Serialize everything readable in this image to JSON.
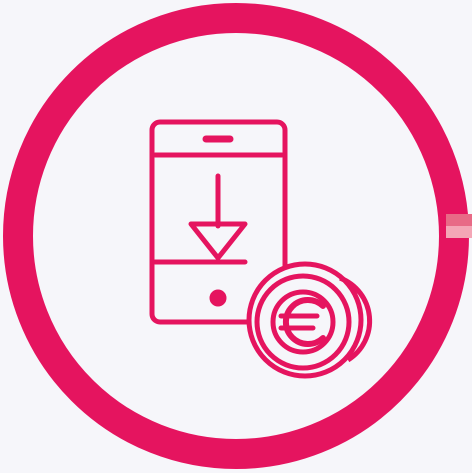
{
  "illustration": {
    "icon": "mobile-payment-download-euro-icon",
    "phone_icon": "smartphone-icon",
    "arrow_icon": "download-arrow-icon",
    "coin_icon": "euro-coin-icon",
    "currency_symbol": "€"
  },
  "colors": {
    "background": "#f6f6fa",
    "ring": "#e5145f",
    "ring_tab_light": "#f4a6b6",
    "ring_tab_mid": "#e86a86",
    "icon_stroke": "#e5145f"
  }
}
